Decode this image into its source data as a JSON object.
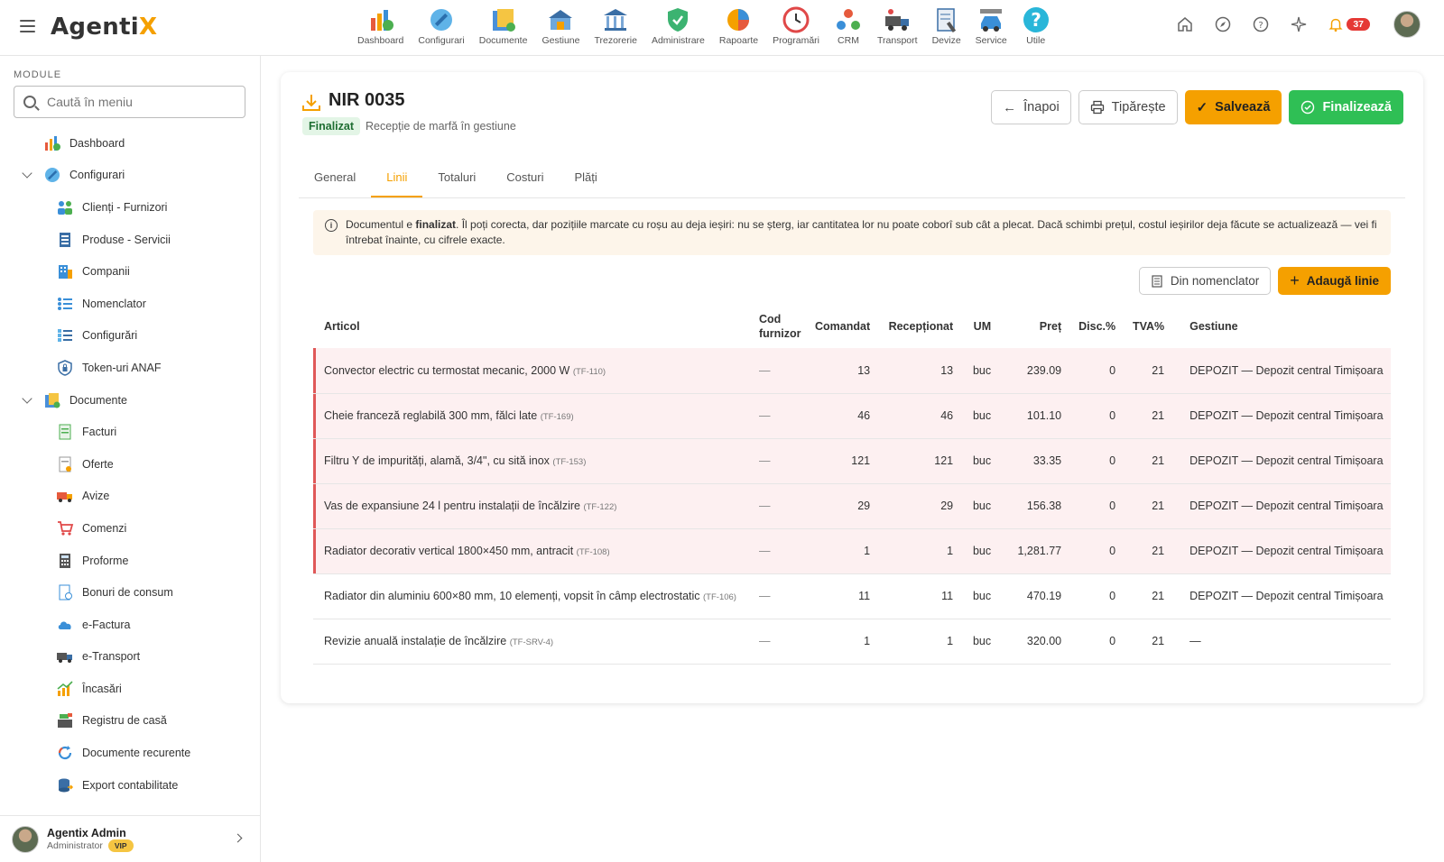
{
  "header": {
    "app_name": "Agenti",
    "app_name_accent": "X",
    "modules": [
      {
        "label": "Dashboard",
        "icon": "dashboard-icon"
      },
      {
        "label": "Configurari",
        "icon": "wrench-icon"
      },
      {
        "label": "Documente",
        "icon": "documents-icon"
      },
      {
        "label": "Gestiune",
        "icon": "warehouse-icon"
      },
      {
        "label": "Trezorerie",
        "icon": "bank-icon"
      },
      {
        "label": "Administrare",
        "icon": "shield-icon"
      },
      {
        "label": "Rapoarte",
        "icon": "pie-chart-icon"
      },
      {
        "label": "Programări",
        "icon": "clock-icon"
      },
      {
        "label": "CRM",
        "icon": "crm-icon"
      },
      {
        "label": "Transport",
        "icon": "truck-icon"
      },
      {
        "label": "Devize",
        "icon": "estimate-icon"
      },
      {
        "label": "Service",
        "icon": "car-service-icon"
      },
      {
        "label": "Utile",
        "icon": "help-icon"
      }
    ],
    "notifications_count": "37"
  },
  "sidebar": {
    "title": "MODULE",
    "search_placeholder": "Caută în meniu",
    "items": [
      {
        "label": "Dashboard",
        "level": 1
      },
      {
        "label": "Configurari",
        "level": 1,
        "expanded": true
      },
      {
        "label": "Clienți - Furnizori",
        "level": 2
      },
      {
        "label": "Produse - Servicii",
        "level": 2
      },
      {
        "label": "Companii",
        "level": 2
      },
      {
        "label": "Nomenclator",
        "level": 2
      },
      {
        "label": "Configurări",
        "level": 2
      },
      {
        "label": "Token-uri ANAF",
        "level": 2
      },
      {
        "label": "Documente",
        "level": 1,
        "expanded": true
      },
      {
        "label": "Facturi",
        "level": 2
      },
      {
        "label": "Oferte",
        "level": 2
      },
      {
        "label": "Avize",
        "level": 2
      },
      {
        "label": "Comenzi",
        "level": 2
      },
      {
        "label": "Proforme",
        "level": 2
      },
      {
        "label": "Bonuri de consum",
        "level": 2
      },
      {
        "label": "e-Factura",
        "level": 2
      },
      {
        "label": "e-Transport",
        "level": 2
      },
      {
        "label": "Încasări",
        "level": 2
      },
      {
        "label": "Registru de casă",
        "level": 2
      },
      {
        "label": "Documente recurente",
        "level": 2
      },
      {
        "label": "Export contabilitate",
        "level": 2
      }
    ],
    "user": {
      "name": "Agentix Admin",
      "role": "Administrator",
      "badge": "VIP"
    }
  },
  "document": {
    "title": "NIR 0035",
    "status": "Finalizat",
    "subtitle": "Recepție de marfă în gestiune",
    "actions": {
      "back": "Înapoi",
      "print": "Tipărește",
      "save": "Salvează",
      "finalize": "Finalizează"
    },
    "tabs": [
      "General",
      "Linii",
      "Totaluri",
      "Costuri",
      "Plăți"
    ],
    "active_tab": "Linii",
    "notice": {
      "pre": "Documentul e ",
      "bold": "finalizat",
      "post": ". Îl poți corecta, dar pozițiile marcate cu roșu au deja ieșiri: nu se șterg, iar cantitatea lor nu poate coborî sub cât a plecat. Dacă schimbi prețul, costul ieșirilor deja făcute se actualizează — vei fi întrebat înainte, cu cifrele exacte."
    },
    "table_actions": {
      "from_catalog": "Din nomenclator",
      "add_line": "Adaugă linie"
    },
    "columns": {
      "article": "Articol",
      "supplier_code_1": "Cod",
      "supplier_code_2": "furnizor",
      "ordered": "Comandat",
      "received": "Recepționat",
      "um": "UM",
      "price": "Preț",
      "disc": "Disc.%",
      "vat": "TVA%",
      "warehouse": "Gestiune"
    },
    "rows": [
      {
        "article": "Convector electric cu termostat mecanic, 2000 W",
        "code": "(TF-110)",
        "supplier_code": "—",
        "ordered": "13",
        "received": "13",
        "um": "buc",
        "price": "239.09",
        "disc": "0",
        "vat": "21",
        "warehouse": "DEPOZIT — Depozit central Timișoara",
        "has_exits": true
      },
      {
        "article": "Cheie franceză reglabilă 300 mm, fălci late",
        "code": "(TF-169)",
        "supplier_code": "—",
        "ordered": "46",
        "received": "46",
        "um": "buc",
        "price": "101.10",
        "disc": "0",
        "vat": "21",
        "warehouse": "DEPOZIT — Depozit central Timișoara",
        "has_exits": true
      },
      {
        "article": "Filtru Y de impurități, alamă, 3/4\", cu sită inox",
        "code": "(TF-153)",
        "supplier_code": "—",
        "ordered": "121",
        "received": "121",
        "um": "buc",
        "price": "33.35",
        "disc": "0",
        "vat": "21",
        "warehouse": "DEPOZIT — Depozit central Timișoara",
        "has_exits": true
      },
      {
        "article": "Vas de expansiune 24 l pentru instalații de încălzire",
        "code": "(TF-122)",
        "supplier_code": "—",
        "ordered": "29",
        "received": "29",
        "um": "buc",
        "price": "156.38",
        "disc": "0",
        "vat": "21",
        "warehouse": "DEPOZIT — Depozit central Timișoara",
        "has_exits": true
      },
      {
        "article": "Radiator decorativ vertical 1800×450 mm, antracit",
        "code": "(TF-108)",
        "supplier_code": "—",
        "ordered": "1",
        "received": "1",
        "um": "buc",
        "price": "1,281.77",
        "disc": "0",
        "vat": "21",
        "warehouse": "DEPOZIT — Depozit central Timișoara",
        "has_exits": true
      },
      {
        "article": "Radiator din aluminiu 600×80 mm, 10 elemenți, vopsit în câmp electrostatic",
        "code": "(TF-106)",
        "supplier_code": "—",
        "ordered": "11",
        "received": "11",
        "um": "buc",
        "price": "470.19",
        "disc": "0",
        "vat": "21",
        "warehouse": "DEPOZIT — Depozit central Timișoara",
        "has_exits": false
      },
      {
        "article": "Revizie anuală instalație de încălzire",
        "code": "(TF-SRV-4)",
        "supplier_code": "—",
        "ordered": "1",
        "received": "1",
        "um": "buc",
        "price": "320.00",
        "disc": "0",
        "vat": "21",
        "warehouse": "—",
        "has_exits": false
      }
    ]
  },
  "colors": {
    "accent": "#f5a000",
    "success": "#2fbf55",
    "danger_row_bg": "#fdf0f1",
    "danger_row_border": "#e05858",
    "notice_bg": "#fdf5ea"
  }
}
